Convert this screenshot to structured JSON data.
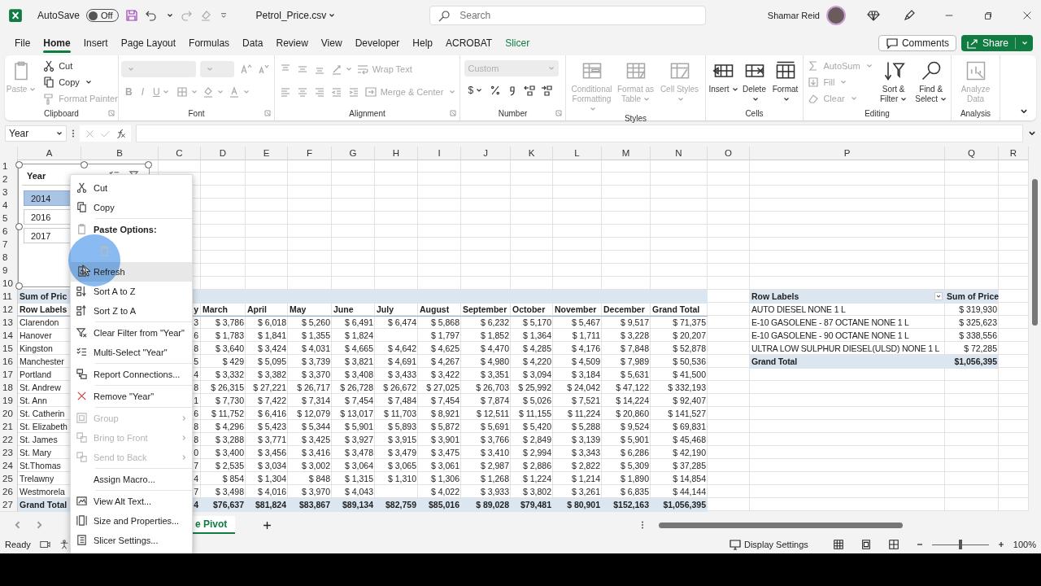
{
  "titlebar": {
    "autosave": {
      "label": "AutoSave",
      "on": false,
      "state_text": "Off"
    },
    "file_name": "Petrol_Price.csv",
    "search": {
      "placeholder": "Search"
    },
    "user": "Shamar Reid"
  },
  "tabs": [
    {
      "label": "File",
      "selected": false,
      "contextual": false
    },
    {
      "label": "Home",
      "selected": true,
      "contextual": false
    },
    {
      "label": "Insert",
      "selected": false,
      "contextual": false
    },
    {
      "label": "Page Layout",
      "selected": false,
      "contextual": false
    },
    {
      "label": "Formulas",
      "selected": false,
      "contextual": false
    },
    {
      "label": "Data",
      "selected": false,
      "contextual": false
    },
    {
      "label": "Review",
      "selected": false,
      "contextual": false
    },
    {
      "label": "View",
      "selected": false,
      "contextual": false
    },
    {
      "label": "Developer",
      "selected": false,
      "contextual": false
    },
    {
      "label": "Help",
      "selected": false,
      "contextual": false
    },
    {
      "label": "ACROBAT",
      "selected": false,
      "contextual": false
    },
    {
      "label": "Slicer",
      "selected": false,
      "contextual": true
    }
  ],
  "comments_button": "Comments",
  "share_button": "Share",
  "ribbon": [
    {
      "label": "Clipboard",
      "launcher": true,
      "columns": [
        [
          {
            "kind": "paste",
            "label": "Paste",
            "disabled": true,
            "caret": true
          }
        ],
        [
          {
            "kind": "cut",
            "label": "Cut",
            "disabled": false,
            "caret": false
          },
          {
            "kind": "copy",
            "label": "Copy",
            "disabled": false,
            "caret": true
          },
          {
            "kind": "painter",
            "label": "Format Painter",
            "disabled": true,
            "caret": false
          }
        ]
      ]
    },
    {
      "label": "Font",
      "launcher": true,
      "rows": [
        [
          {
            "kind": "fontname",
            "disabled": true,
            "caret": true
          },
          {
            "kind": "fontsize",
            "disabled": true,
            "caret": true
          },
          {
            "kind": "grow",
            "disabled": true,
            "caret": false
          },
          {
            "kind": "shrink",
            "disabled": true,
            "caret": false
          }
        ],
        [
          {
            "kind": "bold",
            "label": "B",
            "disabled": true,
            "caret": false
          },
          {
            "kind": "italic",
            "label": "I",
            "disabled": true,
            "caret": false
          },
          {
            "kind": "underline",
            "label": "U",
            "disabled": true,
            "caret": true
          },
          {
            "kind": "borders",
            "disabled": true,
            "caret": true
          },
          {
            "kind": "fill",
            "disabled": true,
            "caret": true
          },
          {
            "kind": "fontcolor",
            "disabled": true,
            "caret": true
          }
        ]
      ]
    },
    {
      "label": "Alignment",
      "launcher": true,
      "rows": [
        [
          {
            "kind": "top",
            "disabled": true,
            "caret": false
          },
          {
            "kind": "middle",
            "disabled": true,
            "caret": false
          },
          {
            "kind": "bottom",
            "disabled": true,
            "caret": false
          },
          {
            "kind": "orient",
            "disabled": true,
            "caret": true
          },
          {
            "kind": "wrap",
            "label": "Wrap Text",
            "disabled": true,
            "caret": false
          }
        ],
        [
          {
            "kind": "left",
            "disabled": true,
            "caret": false
          },
          {
            "kind": "center",
            "disabled": true,
            "caret": false
          },
          {
            "kind": "right",
            "disabled": true,
            "caret": false
          },
          {
            "kind": "outdent",
            "disabled": true,
            "caret": false
          },
          {
            "kind": "indent",
            "disabled": true,
            "caret": false
          },
          {
            "kind": "merge",
            "label": "Merge & Center",
            "disabled": true,
            "caret": true
          }
        ]
      ]
    },
    {
      "label": "Number",
      "launcher": true,
      "rows": [
        [
          {
            "kind": "format",
            "label": "Custom",
            "disabled": true,
            "caret": true
          }
        ],
        [
          {
            "kind": "currency",
            "label": "$",
            "disabled": false,
            "caret": true
          },
          {
            "kind": "percent",
            "disabled": false,
            "caret": false
          },
          {
            "kind": "comma",
            "disabled": false,
            "caret": false
          },
          {
            "kind": "moredecimal",
            "disabled": false,
            "caret": false
          },
          {
            "kind": "lessdecimal",
            "disabled": false,
            "caret": false
          }
        ]
      ]
    },
    {
      "label": "Styles",
      "launcher": false,
      "columns": [
        [
          {
            "kind": "condformat",
            "label": "Conditional Formatting",
            "disabled": true,
            "caret": true
          }
        ],
        [
          {
            "kind": "tablestyle",
            "label": "Format as Table",
            "disabled": true,
            "caret": true
          }
        ],
        [
          {
            "kind": "cellstyle",
            "label": "Cell Styles",
            "disabled": true,
            "caret": true
          }
        ]
      ]
    },
    {
      "label": "Cells",
      "launcher": false,
      "columns": [
        [
          {
            "kind": "insertcells",
            "label": "Insert",
            "disabled": false,
            "caret": true
          }
        ],
        [
          {
            "kind": "deletecells",
            "label": "Delete",
            "disabled": false,
            "caret": true
          }
        ],
        [
          {
            "kind": "formatcells",
            "label": "Format",
            "disabled": false,
            "caret": true
          }
        ]
      ]
    },
    {
      "label": "Editing",
      "launcher": false,
      "columns": [
        [
          {
            "kind": "autosum",
            "label": "AutoSum",
            "disabled": true,
            "caret": true
          },
          {
            "kind": "fillicon",
            "label": "Fill",
            "disabled": true,
            "caret": true
          },
          {
            "kind": "clear",
            "label": "Clear",
            "disabled": true,
            "caret": true
          }
        ],
        [
          {
            "kind": "sort",
            "label": "Sort & Filter",
            "disabled": false,
            "caret": true
          }
        ],
        [
          {
            "kind": "find",
            "label": "Find & Select",
            "disabled": false,
            "caret": true
          }
        ]
      ]
    },
    {
      "label": "Analysis",
      "launcher": false,
      "columns": [
        [
          {
            "kind": "analyze",
            "label": "Analyze Data",
            "disabled": true,
            "caret": false
          }
        ]
      ]
    }
  ],
  "name_box": "Year",
  "columns": [
    "A",
    "B",
    "C",
    "D",
    "E",
    "F",
    "G",
    "H",
    "I",
    "J",
    "K",
    "L",
    "M",
    "N",
    "O",
    "P",
    "Q",
    "R"
  ],
  "row_numbers": [
    "1",
    "2",
    "3",
    "4",
    "5",
    "6",
    "7",
    "8",
    "9",
    "10",
    "11",
    "12",
    "13",
    "14",
    "15",
    "16",
    "17",
    "18",
    "19",
    "20",
    "21",
    "22",
    "23",
    "24",
    "25",
    "26",
    "27"
  ],
  "slicer": {
    "title": "Year",
    "items": [
      {
        "label": "2014",
        "selected": true
      },
      {
        "label": "2016",
        "selected": false
      },
      {
        "label": "2017",
        "selected": false
      }
    ]
  },
  "pivot": {
    "title": "Sum of Pric",
    "row_labels": "Row Labels",
    "partial_header": "y",
    "headers": [
      "March",
      "April",
      "May",
      "June",
      "July",
      "August",
      "September",
      "October",
      "November",
      "December",
      "Grand Total"
    ],
    "rows": [
      {
        "label": "Clarendon",
        "february": "3",
        "march": "$ 3,786",
        "april": "$ 6,018",
        "may": "$ 5,260",
        "june": "$ 6,491",
        "july": "$ 6,474",
        "august": "$ 5,868",
        "september": "$ 6,232",
        "october": "$ 5,170",
        "november": "$ 5,467",
        "december": "$ 9,517",
        "grand_total": "$ 71,375"
      },
      {
        "label": "Hanover",
        "february": "6",
        "march": "$ 1,783",
        "april": "$ 1,841",
        "may": "$ 1,355",
        "june": "$ 1,824",
        "august": "$ 1,797",
        "september": "$ 1,852",
        "october": "$ 1,364",
        "november": "$ 1,711",
        "december": "$ 3,228",
        "grand_total": "$ 20,207"
      },
      {
        "label": "Kingston",
        "february": "8",
        "march": "$ 3,640",
        "april": "$ 3,424",
        "may": "$ 4,031",
        "june": "$ 4,665",
        "july": "$ 4,642",
        "august": "$ 4,625",
        "september": "$ 4,470",
        "october": "$ 4,285",
        "november": "$ 4,176",
        "december": "$ 7,848",
        "grand_total": "$ 52,878"
      },
      {
        "label": "Manchester",
        "february": "5",
        "march": "$ 429",
        "april": "$ 5,095",
        "may": "$ 3,739",
        "june": "$ 3,821",
        "july": "$ 4,691",
        "august": "$ 4,267",
        "september": "$ 4,980",
        "october": "$ 4,220",
        "november": "$ 4,509",
        "december": "$ 7,989",
        "grand_total": "$ 50,536"
      },
      {
        "label": "Portland",
        "february": "4",
        "march": "$ 3,332",
        "april": "$ 3,382",
        "may": "$ 3,370",
        "june": "$ 3,408",
        "july": "$ 3,433",
        "august": "$ 3,422",
        "september": "$ 3,351",
        "october": "$ 3,094",
        "november": "$ 3,184",
        "december": "$ 5,631",
        "grand_total": "$ 41,500"
      },
      {
        "label": "St. Andrew",
        "february": "8",
        "march": "$ 26,315",
        "april": "$ 27,221",
        "may": "$ 26,717",
        "june": "$ 26,728",
        "july": "$ 26,672",
        "august": "$ 27,025",
        "september": "$ 26,703",
        "october": "$ 25,992",
        "november": "$ 24,042",
        "december": "$ 47,122",
        "grand_total": "$ 332,193"
      },
      {
        "label": "St. Ann",
        "february": "1",
        "march": "$ 7,730",
        "april": "$ 7,422",
        "may": "$ 7,314",
        "june": "$ 7,454",
        "july": "$ 7,484",
        "august": "$ 7,454",
        "september": "$ 7,874",
        "october": "$ 5,026",
        "november": "$ 7,521",
        "december": "$ 14,224",
        "grand_total": "$ 92,407"
      },
      {
        "label": "St. Catherin",
        "february": "6",
        "march": "$ 11,752",
        "april": "$ 6,416",
        "may": "$ 12,079",
        "june": "$ 13,017",
        "july": "$ 11,703",
        "august": "$ 8,921",
        "september": "$ 12,511",
        "october": "$ 11,155",
        "november": "$ 11,224",
        "december": "$ 20,860",
        "grand_total": "$ 141,527"
      },
      {
        "label": "St. Elizabeth",
        "february": "8",
        "march": "$ 4,296",
        "april": "$ 5,423",
        "may": "$ 5,344",
        "june": "$ 5,901",
        "july": "$ 5,893",
        "august": "$ 5,872",
        "september": "$ 5,691",
        "october": "$ 5,420",
        "november": "$ 5,288",
        "december": "$ 9,524",
        "grand_total": "$ 69,831"
      },
      {
        "label": "St. James",
        "february": "8",
        "march": "$ 3,288",
        "april": "$ 3,771",
        "may": "$ 3,425",
        "june": "$ 3,927",
        "july": "$ 3,915",
        "august": "$ 3,901",
        "september": "$ 3,766",
        "october": "$ 2,849",
        "november": "$ 3,139",
        "december": "$ 5,901",
        "grand_total": "$ 45,468"
      },
      {
        "label": "St. Mary",
        "february": "0",
        "march": "$ 3,400",
        "april": "$ 3,456",
        "may": "$ 3,416",
        "june": "$ 3,478",
        "july": "$ 3,479",
        "august": "$ 3,475",
        "september": "$ 3,410",
        "october": "$ 2,994",
        "november": "$ 3,343",
        "december": "$ 6,286",
        "grand_total": "$ 42,190"
      },
      {
        "label": "St.Thomas",
        "february": "7",
        "march": "$ 2,535",
        "april": "$ 3,034",
        "may": "$ 3,002",
        "june": "$ 3,064",
        "july": "$ 3,065",
        "august": "$ 3,061",
        "september": "$ 2,987",
        "october": "$ 2,886",
        "november": "$ 2,822",
        "december": "$ 5,309",
        "grand_total": "$ 37,285"
      },
      {
        "label": "Trelawny",
        "february": "4",
        "march": "$ 854",
        "april": "$ 1,304",
        "may": "$ 848",
        "june": "$ 1,315",
        "july": "$ 1,310",
        "august": "$ 1,306",
        "september": "$ 1,268",
        "october": "$ 1,224",
        "november": "$ 1,214",
        "december": "$ 1,890",
        "grand_total": "$ 14,854"
      },
      {
        "label": "Westmorela",
        "february": "7",
        "march": "$ 3,498",
        "april": "$ 4,016",
        "may": "$ 3,970",
        "june": "$ 4,043",
        "august": "$ 4,022",
        "september": "$ 3,933",
        "october": "$ 3,802",
        "november": "$ 3,261",
        "december": "$ 6,835",
        "grand_total": "$ 44,144"
      }
    ],
    "total": {
      "label": "Grand Total",
      "february": "4",
      "march": "$76,637",
      "april": "$81,824",
      "may": "$83,867",
      "june": "$89,134",
      "july": "$82,759",
      "august": "$85,016",
      "september": "$ 89,028",
      "october": "$79,481",
      "november": "$ 80,901",
      "december": "$152,163",
      "grand_total": "$1,056,395"
    }
  },
  "price_pivot": {
    "row_labels": "Row Labels",
    "value_header": "Sum of Price",
    "rows": [
      {
        "label": "AUTO DIESEL NONE 1 L",
        "value": "$ 319,930"
      },
      {
        "label": "E-10 GASOLENE - 87 OCTANE NONE 1 L",
        "value": "$ 325,623"
      },
      {
        "label": "E-10 GASOLENE - 90 OCTANE NONE 1 L",
        "value": "$ 338,556"
      },
      {
        "label": "ULTRA LOW SULPHUR DIESEL(ULSD) NONE 1 L",
        "value": "$ 72,285"
      }
    ],
    "total": {
      "label": "Grand Total",
      "value": "$1,056,395"
    }
  },
  "context_menu": [
    {
      "kind": "cut",
      "label": "Cut",
      "disabled": false,
      "hover": false,
      "submenu": false
    },
    {
      "kind": "copy",
      "label": "Copy",
      "disabled": false,
      "hover": false,
      "submenu": false
    },
    {
      "kind": "pasteheader",
      "label": "Paste Options:",
      "disabled": false,
      "hover": false,
      "submenu": false
    },
    {
      "kind": "pastebutton",
      "disabled": true,
      "hover": false,
      "submenu": false
    },
    {
      "kind": "refresh",
      "label": "Refresh",
      "disabled": false,
      "hover": true,
      "submenu": false
    },
    {
      "kind": "sortaz",
      "label": "Sort A to Z",
      "disabled": false,
      "hover": false,
      "submenu": false
    },
    {
      "kind": "sortza",
      "label": "Sort Z to A",
      "disabled": false,
      "hover": false,
      "submenu": false
    },
    {
      "kind": "clearfilter",
      "label": "Clear Filter from \"Year\"",
      "disabled": false,
      "hover": false,
      "submenu": false
    },
    {
      "kind": "multiselect",
      "label": "Multi-Select \"Year\"",
      "disabled": false,
      "hover": false,
      "submenu": false
    },
    {
      "kind": "connections",
      "label": "Report Connections...",
      "disabled": false,
      "hover": false,
      "submenu": false
    },
    {
      "kind": "remove",
      "label": "Remove \"Year\"",
      "disabled": false,
      "hover": false,
      "submenu": false
    },
    {
      "kind": "group",
      "label": "Group",
      "disabled": true,
      "hover": false,
      "submenu": true
    },
    {
      "kind": "front",
      "label": "Bring to Front",
      "disabled": true,
      "hover": false,
      "submenu": true
    },
    {
      "kind": "back",
      "label": "Send to Back",
      "disabled": true,
      "hover": false,
      "submenu": true
    },
    {
      "kind": "macro",
      "label": "Assign Macro...",
      "disabled": false,
      "hover": false,
      "submenu": false
    },
    {
      "kind": "alttext",
      "label": "View Alt Text...",
      "disabled": false,
      "hover": false,
      "submenu": false
    },
    {
      "kind": "size",
      "label": "Size and Properties...",
      "disabled": false,
      "hover": false,
      "submenu": false
    },
    {
      "kind": "settings",
      "label": "Slicer Settings...",
      "disabled": false,
      "hover": false,
      "submenu": false
    }
  ],
  "sheet_tabs": [
    {
      "label": "e Pivot",
      "selected": true
    }
  ],
  "status_bar": {
    "status": "Ready",
    "display_settings": "Display Settings",
    "zoom": {
      "level": 0.5,
      "reading": "100%"
    }
  }
}
